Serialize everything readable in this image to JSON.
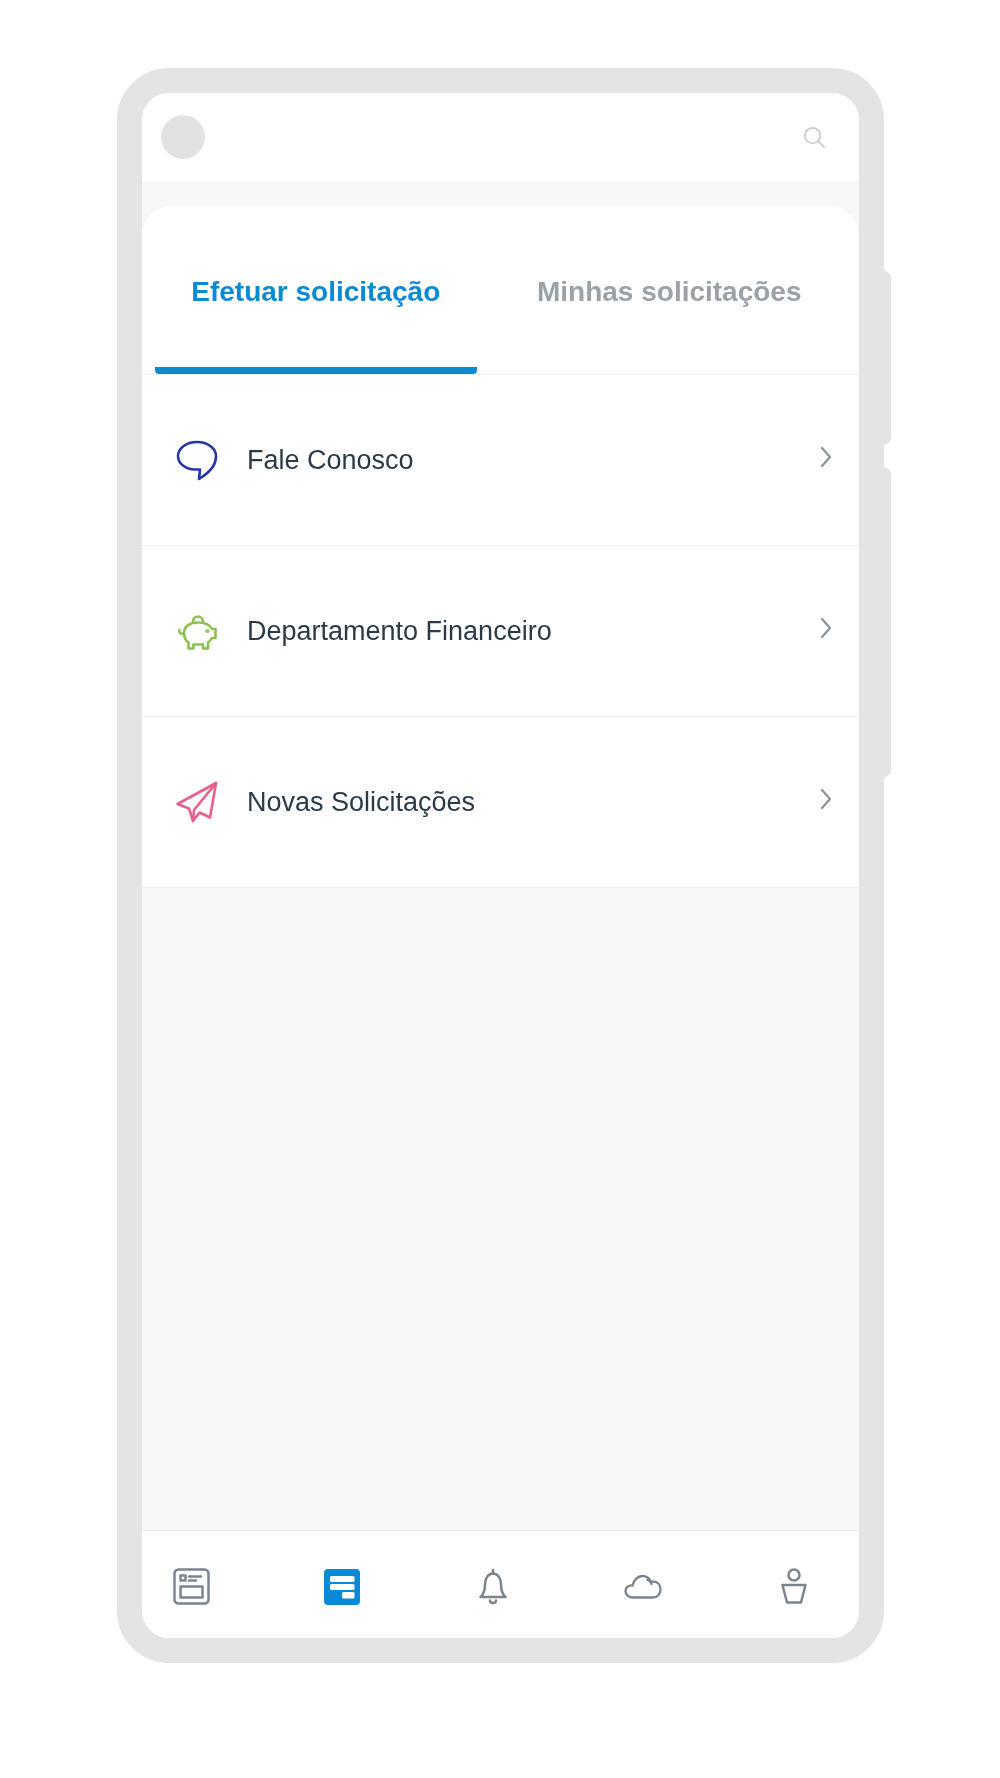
{
  "tabs": [
    {
      "label": "Efetuar solicitação",
      "selected": true
    },
    {
      "label": "Minhas solicitações",
      "selected": false
    }
  ],
  "menu_items": [
    {
      "kind": "contact",
      "label": "Fale Conosco",
      "color": "#2537a5"
    },
    {
      "kind": "finance",
      "label": "Departamento Financeiro",
      "color": "#8cc152"
    },
    {
      "kind": "request",
      "label": "Novas Solicitações",
      "color": "#e8608a"
    }
  ],
  "bottom_nav": [
    {
      "kind": "news",
      "selected": false
    },
    {
      "kind": "requests",
      "selected": true
    },
    {
      "kind": "notifications",
      "selected": false
    },
    {
      "kind": "cloud",
      "selected": false
    },
    {
      "kind": "profile",
      "selected": false
    }
  ]
}
